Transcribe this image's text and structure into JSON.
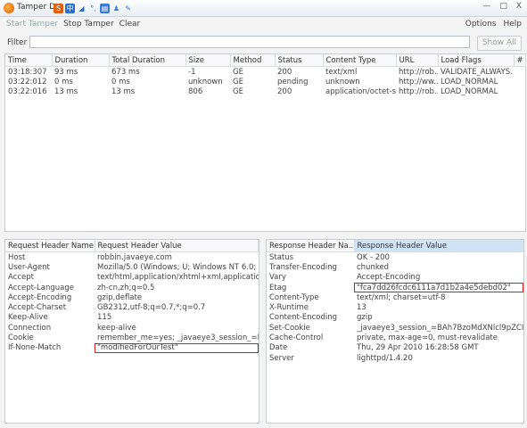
{
  "window": {
    "title": "Tamper Dat",
    "min": "—",
    "max": "□",
    "close": "X"
  },
  "menu": {
    "start": "Start Tamper",
    "stop": "Stop Tamper",
    "clear": "Clear",
    "options": "Options",
    "help": "Help"
  },
  "filter": {
    "label": "Filter",
    "value": "",
    "show_all": "Show All"
  },
  "requests": {
    "columns": [
      "Time",
      "Duration",
      "Total Duration",
      "Size",
      "Method",
      "Status",
      "Content Type",
      "URL",
      "Load Flags",
      "#"
    ],
    "rows": [
      [
        "03:18:307",
        "93 ms",
        "673 ms",
        "-1",
        "GE",
        "200",
        "text/xml",
        "http://rob...",
        "VALIDATE_ALWAYS..."
      ],
      [
        "03:22:012",
        "0 ms",
        "0 ms",
        "unknown",
        "GE",
        "pending",
        "unknown",
        "http://ww...",
        "LOAD_NORMAL"
      ],
      [
        "03:22:016",
        "13 ms",
        "13 ms",
        "806",
        "GE",
        "200",
        "application/octet-s...",
        "http://rob...",
        "LOAD_NORMAL"
      ]
    ]
  },
  "request_headers": {
    "col_name": "Request Header Name",
    "col_value": "Request Header Value",
    "rows": [
      [
        "Host",
        "robbin.javaeye.com"
      ],
      [
        "User-Agent",
        "Mozilla/5.0 (Windows; U; Windows NT 6.0; zh-..."
      ],
      [
        "Accept",
        "text/html,application/xhtml+xml,application/x..."
      ],
      [
        "Accept-Language",
        "zh-cn,zh;q=0.5"
      ],
      [
        "Accept-Encoding",
        "gzip,deflate"
      ],
      [
        "Accept-Charset",
        "GB2312,utf-8;q=0.7,*;q=0.7"
      ],
      [
        "Keep-Alive",
        "115"
      ],
      [
        "Connection",
        "keep-alive"
      ],
      [
        "Cookie",
        "remember_me=yes; _javaeye3_session_=BAh7..."
      ],
      [
        "If-None-Match",
        "\"modifiedForOurTest\""
      ]
    ]
  },
  "response_headers": {
    "col_name": "Response Header Na...",
    "col_value": "Response Header Value",
    "rows": [
      [
        "Status",
        "OK - 200"
      ],
      [
        "Transfer-Encoding",
        "chunked"
      ],
      [
        "Vary",
        "Accept-Encoding"
      ],
      [
        "Etag",
        "\"fca7dd26fcdc6111a7d1b2a4e5debd02\""
      ],
      [
        "Content-Type",
        "text/xml; charset=utf-8"
      ],
      [
        "X-Runtime",
        "13"
      ],
      [
        "Content-Encoding",
        "gzip"
      ],
      [
        "Set-Cookie",
        "_javaeye3_session_=BAh7BzoMdXNlcl9pZCIuKD..."
      ],
      [
        "Cache-Control",
        "private, max-age=0, must-revalidate"
      ],
      [
        "Date",
        "Thu, 29 Apr 2010 16:28:58 GMT"
      ],
      [
        "Server",
        "lighttpd/1.4.20"
      ]
    ]
  }
}
